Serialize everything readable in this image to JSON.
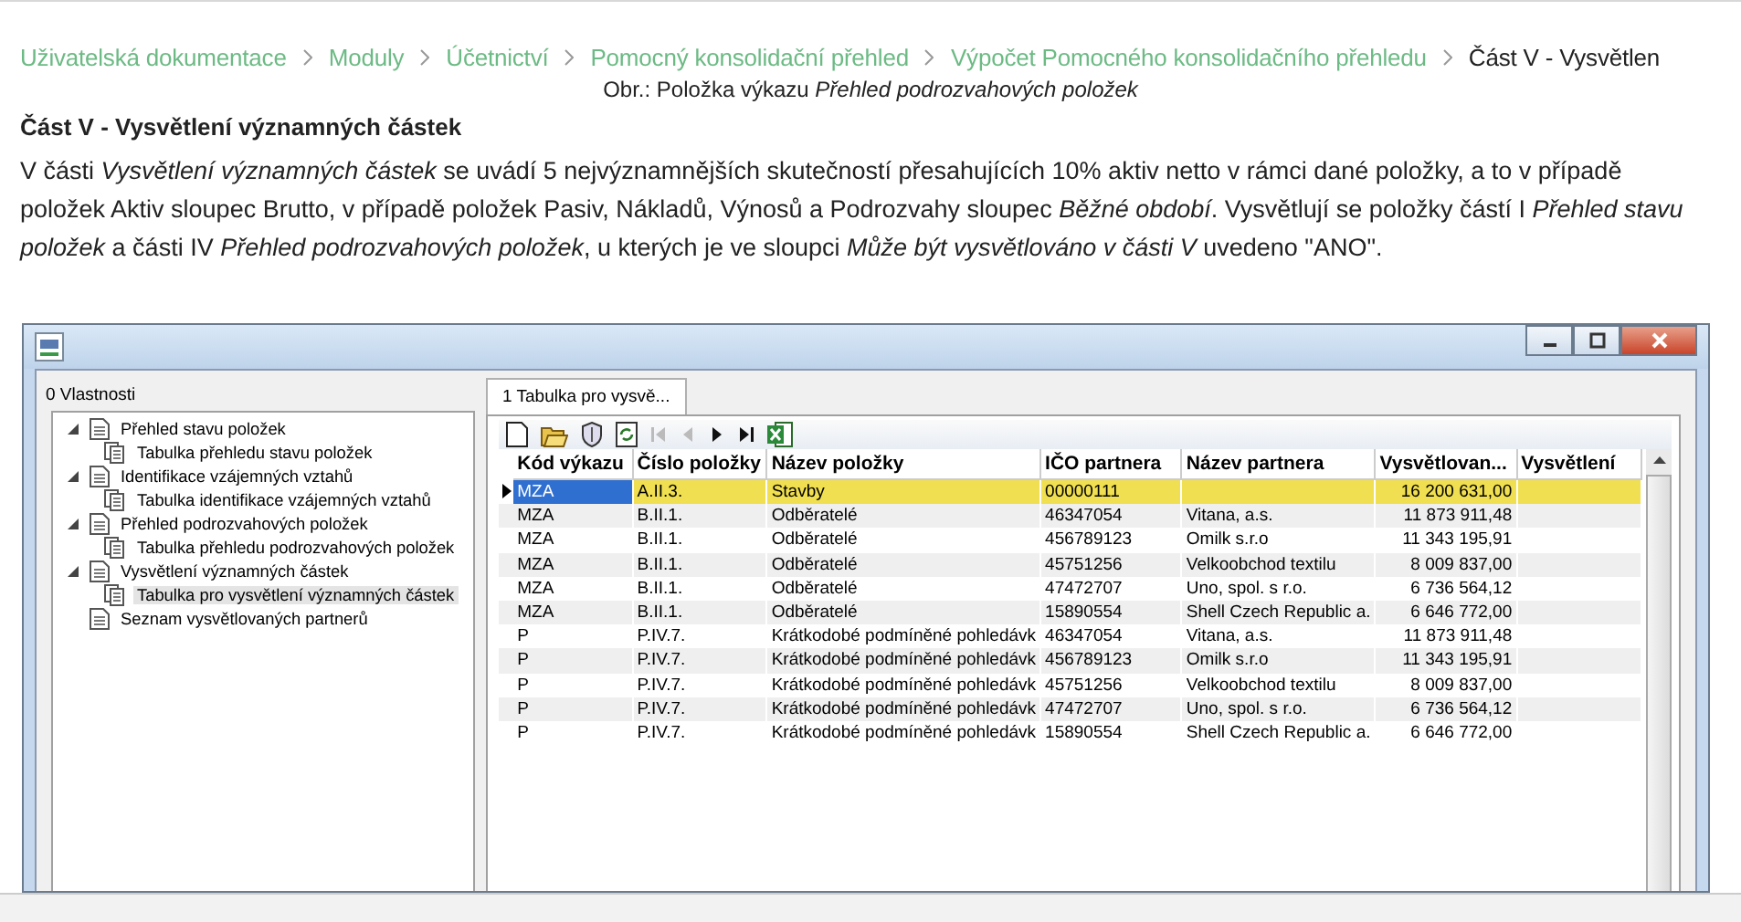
{
  "breadcrumb": [
    {
      "label": "Uživatelská dokumentace",
      "link": true
    },
    {
      "label": "Moduly",
      "link": true
    },
    {
      "label": "Účetnictví",
      "link": true
    },
    {
      "label": "Pomocný konsolidační přehled",
      "link": true
    },
    {
      "label": "Výpočet Pomocného konsolidačního přehledu",
      "link": true
    },
    {
      "label": "Část V - Vysvětlen",
      "link": false
    }
  ],
  "caption": "Obr.: Položka výkazu *Přehled podrozvahových položek*",
  "heading": "Část V - Vysvětlení významných částek",
  "paragraph": "V části *Vysvětlení významných částek* se uvádí 5 nejvýznamnějších skutečností přesahujících 10% aktiv netto v rámci dané položky, a to v případě položek Aktiv sloupec Brutto, v případě položek Pasiv, Nákladů, Výnosů a Podrozvahy sloupec *Běžné období*. Vysvětlují se položky částí I *Přehled stavu položek* a části IV *Přehled podrozvahových položek*, u kterých je ve sloupci *Může být vysvětlováno v části V* uvedeno \"ANO\".",
  "window": {
    "left_panel": {
      "title": "0 Vlastnosti",
      "tree": [
        {
          "label": "Přehled stavu položek",
          "expanded": true,
          "selected": false,
          "children": [
            {
              "label": "Tabulka přehledu stavu položek",
              "selected": false
            }
          ]
        },
        {
          "label": "Identifikace vzájemných vztahů",
          "expanded": true,
          "selected": false,
          "children": [
            {
              "label": "Tabulka identifikace vzájemných vztahů",
              "selected": false
            }
          ]
        },
        {
          "label": "Přehled podrozvahových položek",
          "expanded": true,
          "selected": false,
          "children": [
            {
              "label": "Tabulka přehledu podrozvahových položek",
              "selected": false
            }
          ]
        },
        {
          "label": "Vysvětlení významných částek",
          "expanded": true,
          "selected": false,
          "children": [
            {
              "label": "Tabulka pro vysvětlení významných částek",
              "selected": true
            }
          ]
        },
        {
          "label": "Seznam vysvětlovaných partnerů",
          "expanded": false,
          "selected": false
        }
      ]
    },
    "tabs": [
      {
        "label": "1 Tabulka pro vysvě...",
        "selected": true
      }
    ],
    "toolbar": [
      {
        "kind": "new",
        "disabled": false
      },
      {
        "kind": "open",
        "disabled": false
      },
      {
        "kind": "shield",
        "disabled": false
      },
      {
        "kind": "refresh",
        "disabled": false
      },
      {
        "kind": "first",
        "disabled": true
      },
      {
        "kind": "prev",
        "disabled": true
      },
      {
        "kind": "next",
        "disabled": false
      },
      {
        "kind": "last",
        "disabled": false
      },
      {
        "kind": "excel",
        "disabled": false
      }
    ],
    "table": {
      "columns": [
        "Kód výkazu",
        "Číslo položky",
        "Název položky",
        "IČO partnera",
        "Název partnera",
        "Vysvětlovan...",
        "Vysvětlení"
      ],
      "rows": [
        {
          "selected": true,
          "cells": [
            "MZA",
            "A.II.3.",
            "Stavby",
            "00000111",
            "",
            "16 200 631,00",
            ""
          ]
        },
        {
          "selected": false,
          "cells": [
            "MZA",
            "B.II.1.",
            "Odběratelé",
            "46347054",
            "Vitana, a.s.",
            "11 873 911,48",
            ""
          ]
        },
        {
          "selected": false,
          "cells": [
            "MZA",
            "B.II.1.",
            "Odběratelé",
            "456789123",
            "Omilk s.r.o",
            "11 343 195,91",
            ""
          ]
        },
        {
          "selected": false,
          "cells": [
            "MZA",
            "B.II.1.",
            "Odběratelé",
            "45751256",
            "Velkoobchod textilu",
            "8 009 837,00",
            ""
          ]
        },
        {
          "selected": false,
          "cells": [
            "MZA",
            "B.II.1.",
            "Odběratelé",
            "47472707",
            "Uno, spol. s r.o.",
            "6 736 564,12",
            ""
          ]
        },
        {
          "selected": false,
          "cells": [
            "MZA",
            "B.II.1.",
            "Odběratelé",
            "15890554",
            "Shell Czech Republic a.",
            "6 646 772,00",
            ""
          ]
        },
        {
          "selected": false,
          "cells": [
            "P",
            "P.IV.7.",
            "Krátkodobé podmíněné pohledávk",
            "46347054",
            "Vitana, a.s.",
            "11 873 911,48",
            ""
          ]
        },
        {
          "selected": false,
          "cells": [
            "P",
            "P.IV.7.",
            "Krátkodobé podmíněné pohledávk",
            "456789123",
            "Omilk s.r.o",
            "11 343 195,91",
            ""
          ]
        },
        {
          "selected": false,
          "cells": [
            "P",
            "P.IV.7.",
            "Krátkodobé podmíněné pohledávk",
            "45751256",
            "Velkoobchod textilu",
            "8 009 837,00",
            ""
          ]
        },
        {
          "selected": false,
          "cells": [
            "P",
            "P.IV.7.",
            "Krátkodobé podmíněné pohledávk",
            "47472707",
            "Uno, spol. s r.o.",
            "6 736 564,12",
            ""
          ]
        },
        {
          "selected": false,
          "cells": [
            "P",
            "P.IV.7.",
            "Krátkodobé podmíněné pohledávk",
            "15890554",
            "Shell Czech Republic a.",
            "6 646 772,00",
            ""
          ]
        }
      ]
    }
  }
}
